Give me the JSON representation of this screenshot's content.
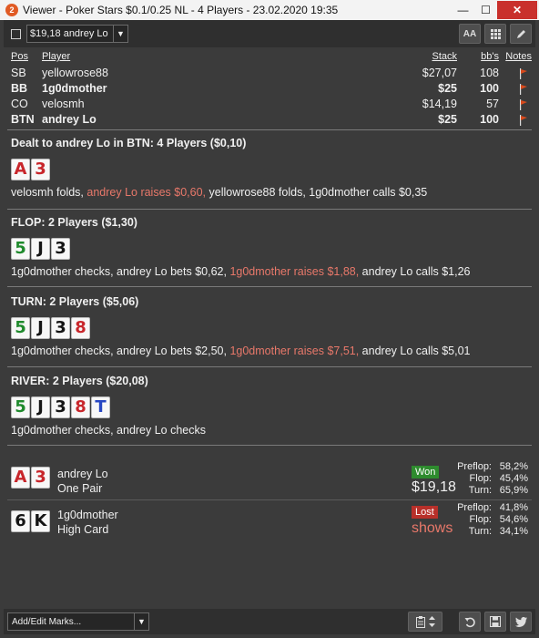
{
  "window": {
    "title": "Viewer - Poker Stars $0.1/0.25 NL - 4 Players - 23.02.2020 19:35",
    "app_icon": "2",
    "min": "—",
    "max": "☐",
    "close": "✕"
  },
  "toolbar": {
    "hand_select_value": "$19,18 andrey Lo",
    "dropdown_arrow": "▼",
    "font_button": "AA",
    "grid_button_icon": "grid-icon",
    "edit_button_icon": "pencil-icon"
  },
  "players_table": {
    "headers": {
      "pos": "Pos",
      "player": "Player",
      "stack": "Stack",
      "bbs": "bb's",
      "notes": "Notes"
    },
    "rows": [
      {
        "pos": "SB",
        "player": "yellowrose88",
        "stack": "$27,07",
        "bbs": "108",
        "bold": false
      },
      {
        "pos": "BB",
        "player": "1g0dmother",
        "stack": "$25",
        "bbs": "100",
        "bold": true
      },
      {
        "pos": "CO",
        "player": "velosmh",
        "stack": "$14,19",
        "bbs": "57",
        "bold": false
      },
      {
        "pos": "BTN",
        "player": "andrey Lo",
        "stack": "$25",
        "bbs": "100",
        "bold": true
      }
    ]
  },
  "streets": {
    "preflop": {
      "header": "Dealt to andrey Lo in BTN: 4 Players ($0,10)",
      "cards": [
        {
          "rank": "A",
          "suit": "h"
        },
        {
          "rank": "3",
          "suit": "h"
        }
      ],
      "actions": [
        {
          "text": "velosmh folds, ",
          "highlight": false
        },
        {
          "text": "andrey Lo raises $0,60, ",
          "highlight": true
        },
        {
          "text": "yellowrose88 folds, 1g0dmother calls $0,35",
          "highlight": false
        }
      ]
    },
    "flop": {
      "header": "FLOP: 2 Players ($1,30)",
      "cards": [
        {
          "rank": "5",
          "suit": "c"
        },
        {
          "rank": "J",
          "suit": "s"
        },
        {
          "rank": "3",
          "suit": "s"
        }
      ],
      "actions": [
        {
          "text": "1g0dmother checks, andrey Lo bets $0,62, ",
          "highlight": false
        },
        {
          "text": "1g0dmother raises $1,88, ",
          "highlight": true
        },
        {
          "text": "andrey Lo calls $1,26",
          "highlight": false
        }
      ]
    },
    "turn": {
      "header": "TURN: 2 Players ($5,06)",
      "cards": [
        {
          "rank": "5",
          "suit": "c"
        },
        {
          "rank": "J",
          "suit": "s"
        },
        {
          "rank": "3",
          "suit": "s"
        },
        {
          "rank": "8",
          "suit": "h"
        }
      ],
      "actions": [
        {
          "text": "1g0dmother checks, andrey Lo bets $2,50, ",
          "highlight": false
        },
        {
          "text": "1g0dmother raises $7,51, ",
          "highlight": true
        },
        {
          "text": "andrey Lo calls $5,01",
          "highlight": false
        }
      ]
    },
    "river": {
      "header": "RIVER: 2 Players ($20,08)",
      "cards": [
        {
          "rank": "5",
          "suit": "c"
        },
        {
          "rank": "J",
          "suit": "s"
        },
        {
          "rank": "3",
          "suit": "s"
        },
        {
          "rank": "8",
          "suit": "h"
        },
        {
          "rank": "T",
          "suit": "d"
        }
      ],
      "actions": [
        {
          "text": "1g0dmother checks, andrey Lo checks",
          "highlight": false
        }
      ]
    }
  },
  "results": [
    {
      "player": "andrey Lo",
      "hand": "One Pair",
      "cards": [
        {
          "rank": "A",
          "suit": "h"
        },
        {
          "rank": "3",
          "suit": "h"
        }
      ],
      "badge": "Won",
      "amount": "$19,18",
      "equity": [
        {
          "label": "Preflop:",
          "value": "58,2%"
        },
        {
          "label": "Flop:",
          "value": "45,4%"
        },
        {
          "label": "Turn:",
          "value": "65,9%"
        }
      ]
    },
    {
      "player": "1g0dmother",
      "hand": "High Card",
      "cards": [
        {
          "rank": "6",
          "suit": "s"
        },
        {
          "rank": "K",
          "suit": "s"
        }
      ],
      "badge": "Lost",
      "amount": "shows",
      "equity": [
        {
          "label": "Preflop:",
          "value": "41,8%"
        },
        {
          "label": "Flop:",
          "value": "54,6%"
        },
        {
          "label": "Turn:",
          "value": "34,1%"
        }
      ]
    }
  ],
  "bottombar": {
    "marks_select": "Add/Edit Marks...",
    "dropdown_arrow": "▼",
    "icons": [
      "clipboard-icon",
      "stepper-icon",
      "undo-icon",
      "save-icon",
      "twitter-icon"
    ]
  },
  "colors": {
    "highlight_action": "#e8786a",
    "won_badge": "#2e8b2e",
    "lost_badge": "#b8302a",
    "hearts": "#c8262b",
    "diamonds": "#2746c2",
    "clubs": "#1f8a2c",
    "spades": "#151515"
  }
}
